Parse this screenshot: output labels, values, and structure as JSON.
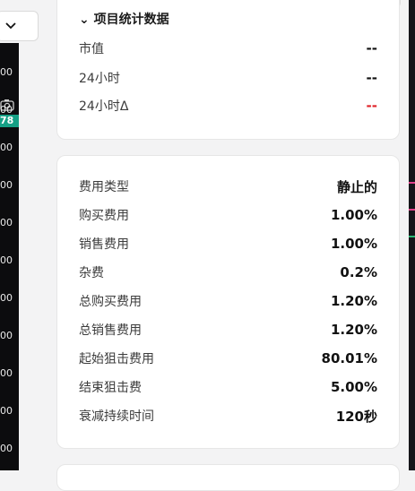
{
  "chart_strip": {
    "axis_labels": [
      "00",
      "00",
      "78",
      "00",
      "00",
      "00",
      "00",
      "00",
      "00",
      "00",
      "00",
      "00"
    ],
    "active_index": 2
  },
  "market_card": {
    "header": "项目统计数据",
    "rows": [
      {
        "label": "市值",
        "value": "--"
      },
      {
        "label": "24小时",
        "value": "--"
      },
      {
        "label": "24小时Δ",
        "value": "--"
      }
    ]
  },
  "fees_card": {
    "rows": [
      {
        "label": "费用类型",
        "value": "静止的"
      },
      {
        "label": "购买费用",
        "value": "1.00%"
      },
      {
        "label": "销售费用",
        "value": "1.00%"
      },
      {
        "label": "杂费",
        "value": "0.2%"
      },
      {
        "label": "总购买费用",
        "value": "1.20%"
      },
      {
        "label": "总销售费用",
        "value": "1.20%"
      },
      {
        "label": "起始狙击费用",
        "value": "80.01%"
      },
      {
        "label": "结束狙击费",
        "value": "5.00%"
      },
      {
        "label": "衰减持续时间",
        "value": "120秒"
      }
    ]
  },
  "colors": {
    "negative": "#e0242a",
    "active_label_bg": "#16a085",
    "chart_bg": "#0c0c0e"
  },
  "icons": [
    "chevron-down-icon",
    "camera-icon"
  ]
}
